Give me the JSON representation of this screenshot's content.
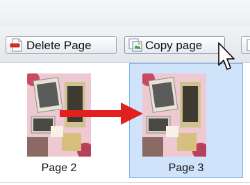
{
  "toolbar": {
    "delete_page_label": "Delete Page",
    "copy_page_label": "Copy page",
    "delete_icon": "delete-page-icon",
    "copy_icon": "copy-page-icon",
    "next_icon": "page-icon"
  },
  "pages": [
    {
      "label": "Page 2",
      "selected": false
    },
    {
      "label": "Page 3",
      "selected": true
    }
  ],
  "colors": {
    "selection_fill": "#cfe3fb",
    "selection_border": "#7fb0ea",
    "arrow": "#e1201f"
  }
}
